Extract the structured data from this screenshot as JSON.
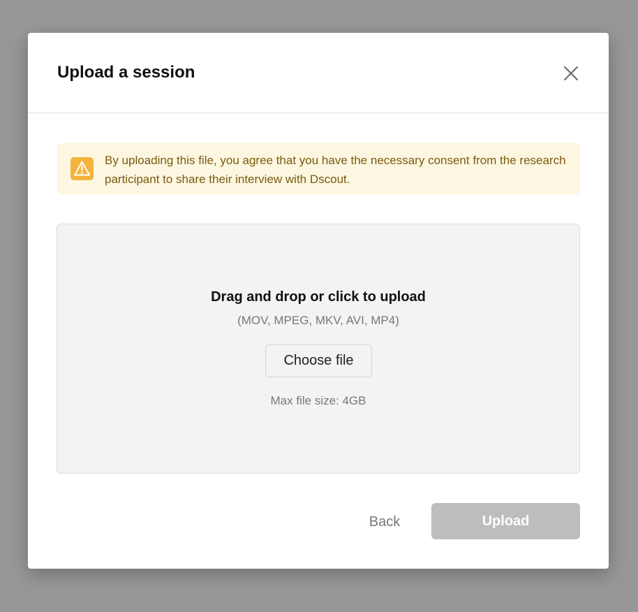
{
  "modal": {
    "title": "Upload a session",
    "close_icon": "close-icon"
  },
  "notice": {
    "icon": "warning-icon",
    "icon_color": "#f3b33d",
    "background_color": "#fdf7e1",
    "text": "By uploading this file, you agree that you have the necessary consent from the research participant to share their interview with Dscout."
  },
  "dropzone": {
    "title": "Drag and drop or click to upload",
    "formats": "(MOV, MPEG, MKV, AVI, MP4)",
    "choose_label": "Choose file",
    "max_size": "Max file size: 4GB"
  },
  "footer": {
    "back_label": "Back",
    "upload_label": "Upload",
    "upload_disabled": true,
    "upload_color": "#bdbdbd"
  }
}
